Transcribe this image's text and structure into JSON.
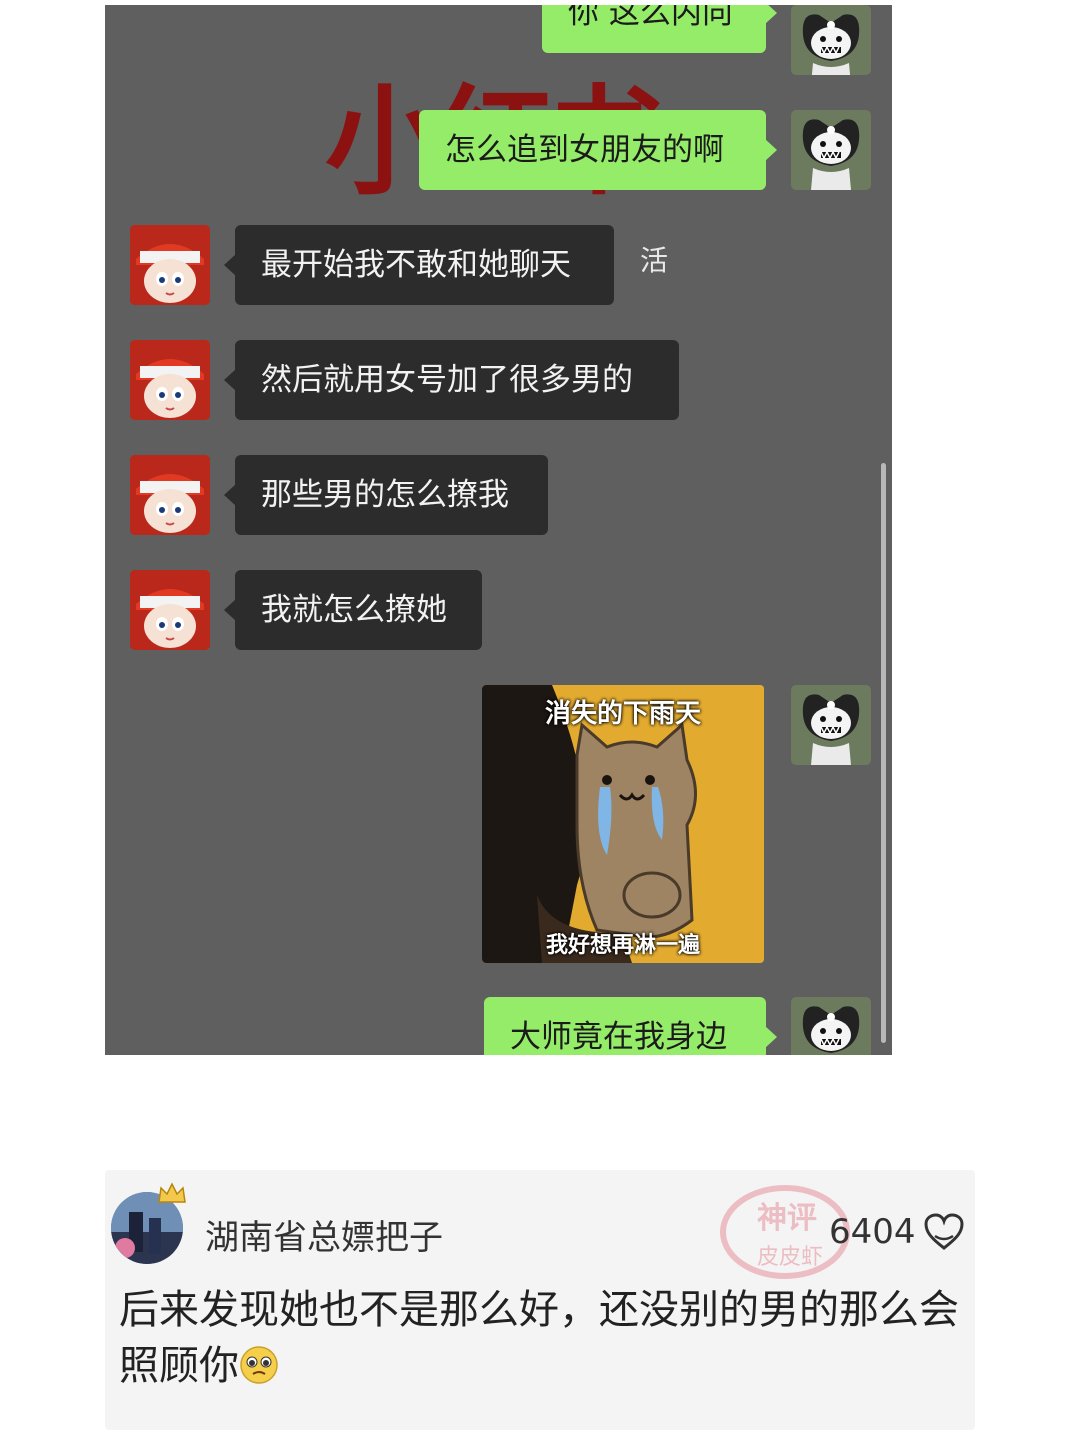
{
  "chat": {
    "watermark": "小红书",
    "side_char": "活",
    "messages": [
      {
        "id": "m1",
        "direction": "out",
        "sender": "kuromi-avatar",
        "text": "你 这么内向"
      },
      {
        "id": "m2",
        "direction": "out",
        "sender": "kuromi-avatar",
        "text": "怎么追到女朋友的啊"
      },
      {
        "id": "m3",
        "direction": "in",
        "sender": "red-cap-avatar",
        "text": "最开始我不敢和她聊天"
      },
      {
        "id": "m4",
        "direction": "in",
        "sender": "red-cap-avatar",
        "text": "然后就用女号加了很多男的"
      },
      {
        "id": "m5",
        "direction": "in",
        "sender": "red-cap-avatar",
        "text": "那些男的怎么撩我"
      },
      {
        "id": "m6",
        "direction": "in",
        "sender": "red-cap-avatar",
        "text": "我就怎么撩她"
      },
      {
        "id": "m7",
        "direction": "out",
        "sender": "kuromi-avatar",
        "type": "sticker",
        "sticker_top": "消失的下雨天",
        "sticker_bottom": "我好想再淋一遍"
      },
      {
        "id": "m8",
        "direction": "out",
        "sender": "kuromi-avatar",
        "text": "大师竟在我身边"
      }
    ],
    "colors": {
      "background": "#5f5f5f",
      "outgoing_bubble": "#95ec69",
      "incoming_bubble": "#2c2c2c",
      "watermark": "#8c1212"
    }
  },
  "comment": {
    "username": "湖南省总嫖把子",
    "likes": "6404",
    "text": "后来发现她也不是那么好，还没别的男的那么会照顾你",
    "emoji": "pleading-face-emoji",
    "stamp_text": [
      "神评",
      "皮皮虾"
    ],
    "icons": [
      "crown-icon",
      "heart-icon"
    ]
  }
}
